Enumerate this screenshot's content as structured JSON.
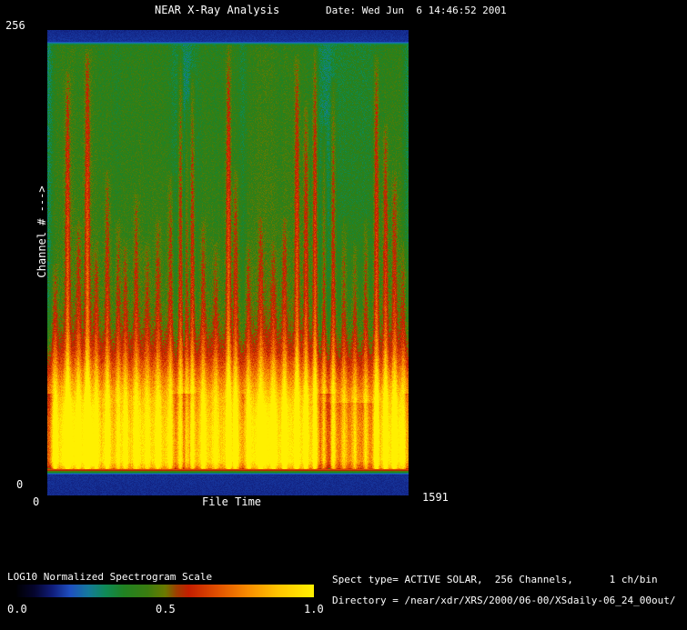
{
  "header": {
    "title": "NEAR X-Ray Analysis",
    "date": "Date: Wed Jun  6 14:46:52 2001"
  },
  "plot": {
    "y_axis": {
      "max_label": "256",
      "min_label": "0",
      "label": "Channel # --->"
    },
    "x_axis": {
      "min_label": "0",
      "label": "File Time",
      "max_label": "1591"
    }
  },
  "colorbar": {
    "title": "LOG10 Normalized Spectrogram Scale",
    "tick_labels": [
      "0.0",
      "0.5",
      "1.0"
    ]
  },
  "info": {
    "spect_line": "Spect type= ACTIVE SOLAR,  256 Channels,      1 ch/bin",
    "dir_line": "Directory = /near/xdr/XRS/2000/06-00/XSdaily-06_24_00out/"
  },
  "colors": {
    "background": "#000000",
    "text": "#ffffff"
  },
  "chart_data": {
    "type": "heatmap",
    "title": "NEAR X-Ray Analysis",
    "subtitle": "Date: Wed Jun  6 14:46:52 2001",
    "xlabel": "File Time",
    "ylabel": "Channel # --->",
    "xlim": [
      0,
      1591
    ],
    "ylim": [
      0,
      256
    ],
    "value_scale": {
      "label": "LOG10 Normalized Spectrogram Scale",
      "min": 0.0,
      "max": 1.0,
      "ticks": [
        0.0,
        0.5,
        1.0
      ]
    },
    "legend": "none",
    "grid": false,
    "colorbar": {
      "position": "bottom-left",
      "stops": [
        {
          "p": 0.0,
          "c": "#000004"
        },
        {
          "p": 0.06,
          "c": "#05052e"
        },
        {
          "p": 0.12,
          "c": "#101d7a"
        },
        {
          "p": 0.18,
          "c": "#1e4fc0"
        },
        {
          "p": 0.24,
          "c": "#15799c"
        },
        {
          "p": 0.3,
          "c": "#0f8a56"
        },
        {
          "p": 0.36,
          "c": "#208222"
        },
        {
          "p": 0.44,
          "c": "#3a7d10"
        },
        {
          "p": 0.5,
          "c": "#6b7a00"
        },
        {
          "p": 0.54,
          "c": "#a03c00"
        },
        {
          "p": 0.58,
          "c": "#c41e00"
        },
        {
          "p": 0.68,
          "c": "#e25200"
        },
        {
          "p": 0.78,
          "c": "#f88c00"
        },
        {
          "p": 0.88,
          "c": "#ffc400"
        },
        {
          "p": 1.0,
          "c": "#fff000"
        }
      ]
    },
    "base_profile": [
      [
        0.0,
        0.135
      ],
      [
        0.046,
        0.14
      ],
      [
        0.06,
        0.82
      ],
      [
        0.075,
        0.955
      ],
      [
        0.15,
        0.94
      ],
      [
        0.21,
        0.87
      ],
      [
        0.26,
        0.73
      ],
      [
        0.31,
        0.58
      ],
      [
        0.36,
        0.49
      ],
      [
        0.42,
        0.45
      ],
      [
        0.55,
        0.425
      ],
      [
        0.75,
        0.41
      ],
      [
        0.95,
        0.4
      ],
      [
        0.968,
        0.4
      ],
      [
        0.976,
        0.145
      ],
      [
        1.0,
        0.135
      ]
    ],
    "streaks": [
      [
        0.02,
        0.5,
        0.2
      ],
      [
        0.055,
        0.92,
        0.3
      ],
      [
        0.085,
        0.6,
        0.22
      ],
      [
        0.11,
        0.96,
        0.32
      ],
      [
        0.135,
        0.55,
        0.2
      ],
      [
        0.165,
        0.7,
        0.24
      ],
      [
        0.195,
        0.6,
        0.22
      ],
      [
        0.215,
        0.55,
        0.2
      ],
      [
        0.245,
        0.65,
        0.22
      ],
      [
        0.275,
        0.55,
        0.2
      ],
      [
        0.305,
        0.6,
        0.22
      ],
      [
        0.34,
        0.7,
        0.24
      ],
      [
        0.368,
        0.97,
        0.32
      ],
      [
        0.385,
        0.85,
        0.26
      ],
      [
        0.4,
        0.92,
        0.3
      ],
      [
        0.43,
        0.6,
        0.22
      ],
      [
        0.465,
        0.55,
        0.2
      ],
      [
        0.5,
        0.97,
        0.32
      ],
      [
        0.52,
        0.7,
        0.24
      ],
      [
        0.555,
        0.55,
        0.2
      ],
      [
        0.59,
        0.6,
        0.22
      ],
      [
        0.625,
        0.55,
        0.2
      ],
      [
        0.655,
        0.6,
        0.22
      ],
      [
        0.69,
        0.95,
        0.3
      ],
      [
        0.715,
        0.85,
        0.26
      ],
      [
        0.74,
        0.97,
        0.32
      ],
      [
        0.765,
        0.8,
        0.26
      ],
      [
        0.79,
        0.9,
        0.3
      ],
      [
        0.82,
        0.6,
        0.22
      ],
      [
        0.85,
        0.55,
        0.2
      ],
      [
        0.88,
        0.6,
        0.22
      ],
      [
        0.91,
        0.95,
        0.3
      ],
      [
        0.935,
        0.8,
        0.26
      ],
      [
        0.96,
        0.7,
        0.24
      ],
      [
        0.985,
        0.55,
        0.2
      ]
    ],
    "gaps": [
      [
        0.0,
        0.01,
        0.3
      ],
      [
        0.38,
        0.022,
        0.28
      ],
      [
        0.54,
        0.006,
        0.15
      ],
      [
        0.77,
        0.018,
        0.22
      ],
      [
        0.995,
        0.008,
        0.2
      ]
    ]
  }
}
